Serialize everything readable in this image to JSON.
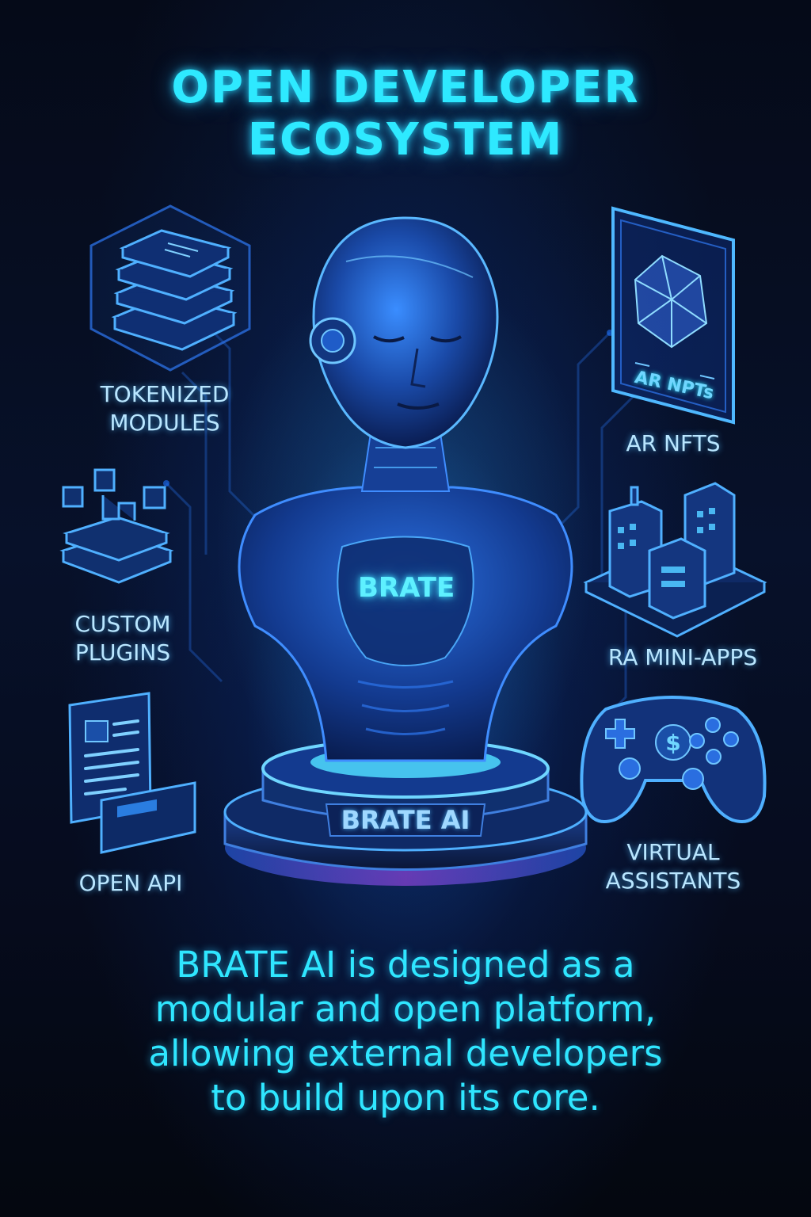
{
  "title": {
    "line1": "OPEN DEVELOPER",
    "line2": "ECOSYSTEM"
  },
  "features": {
    "tokenized_modules": {
      "line1": "TOKENIZED",
      "line2": "MODULES",
      "icon": "book-stack-icon"
    },
    "custom_plugins": {
      "line1": "CUSTOM",
      "line2": "PLUGINS",
      "icon": "plugin-blocks-icon"
    },
    "open_api": {
      "line1": "OPEN API",
      "icon": "document-laptop-icon"
    },
    "ar_nfts": {
      "line1": "AR NFTS",
      "card_text": "AR NPTs",
      "icon": "crystal-card-icon"
    },
    "ra_mini_apps": {
      "line1": "RA MINI-APPS",
      "icon": "city-buildings-icon"
    },
    "virtual_assistants": {
      "line1": "VIRTUAL",
      "line2": "ASSISTANTS",
      "icon": "gamepad-icon",
      "pad_symbol": "$"
    }
  },
  "hero": {
    "chest_label": "BRATE",
    "base_label": "BRATE AI"
  },
  "description": {
    "line1": "BRATE AI is designed as a",
    "line2": "modular and open platform,",
    "line3": "allowing external developers",
    "line4": "to build upon its core."
  },
  "colors": {
    "accent": "#2ee9ff",
    "glow_blue": "#1e7bff",
    "base_magenta": "#b04dff",
    "background": "#040914"
  }
}
